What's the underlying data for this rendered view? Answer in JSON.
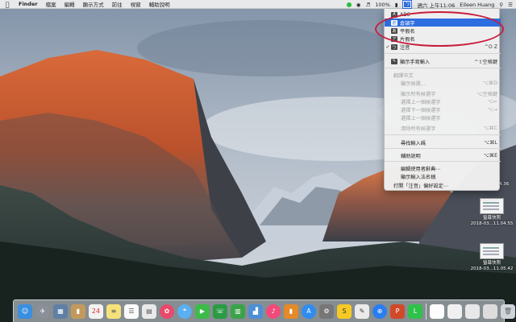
{
  "menubar": {
    "apple_icon": "apple-icon",
    "items": [
      "Finder",
      "檔案",
      "編輯",
      "顯示方式",
      "前往",
      "視窗",
      "輔助說明"
    ],
    "status": {
      "battery": "100%",
      "clock": "週六 上午11:06",
      "user": "Eileen Huang"
    }
  },
  "input_menu": {
    "items": {
      "abc": "ABC",
      "pinyin": "倉頡字",
      "hiragana": "平假名",
      "katakana": "片假名",
      "zhuyin": "注音",
      "zhuyin_shortcut": "^O Z",
      "handwriting": "顯示手寫輸入",
      "handwriting_shortcut": "^⇧空格鍵",
      "section_header": "翻譯中文",
      "d1": "顯示候選...",
      "d1_sc": "⌥⌘D",
      "d2": "顯示所有候選字",
      "d2_sc": "⌥空格鍵",
      "d3": "選擇上一個候選字",
      "d3_sc": "⌥←",
      "d4": "選擇下一個候選字",
      "d4_sc": "⌥→",
      "d5": "選擇上一個候選字",
      "d5_sc": "",
      "d6": "清除所有候選字",
      "d6_sc": "⌥⌘C",
      "find": "尋找輸入碼",
      "find_sc": "⌥⌘L",
      "help": "輔助說明",
      "help_sc": "⌥⌘E",
      "dict": "編輯使用者辭典⋯",
      "list": "顯示輸入法名稱",
      "prefs": "打開「注音」偏好設定⋯"
    }
  },
  "desktop_files": [
    {
      "name": "螢幕快照",
      "date": "2018-03...11.04.55"
    },
    {
      "name": "螢幕快照",
      "date": "2018-03...11.05.42"
    }
  ],
  "partial_file_label": "4.36",
  "colors": {
    "highlight": "#2d6ddf",
    "annotation": "#c81c3a"
  }
}
